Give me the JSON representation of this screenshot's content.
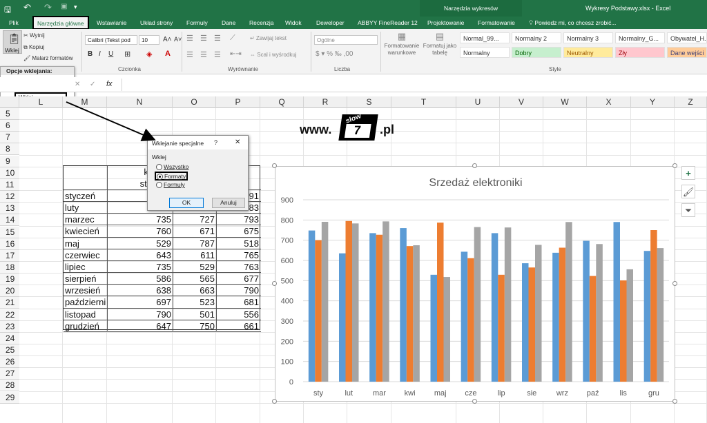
{
  "window": {
    "title": "Wykresy Podstawy.xlsx - Excel",
    "context_group": "Narzędzia wykresów",
    "tell_me": "Powiedz mi, co chcesz zrobić..."
  },
  "tabs": [
    {
      "label": "Plik"
    },
    {
      "label": "Narzędzia główne"
    },
    {
      "label": "Wstawianie"
    },
    {
      "label": "Układ strony"
    },
    {
      "label": "Formuły"
    },
    {
      "label": "Dane"
    },
    {
      "label": "Recenzja"
    },
    {
      "label": "Widok"
    },
    {
      "label": "Deweloper"
    },
    {
      "label": "ABBYY FineReader 12"
    },
    {
      "label": "Projektowanie"
    },
    {
      "label": "Formatowanie"
    }
  ],
  "ribbon": {
    "paste_label": "Wklej",
    "cut_label": "Wytnij",
    "copy_label": "Kopiuj",
    "painter_label": "Malarz formatów",
    "font_name": "Calibri (Tekst pod",
    "font_size": "10",
    "wrap_text": "Zawijaj tekst",
    "merge_center": "Scal i wyśrodkuj",
    "number_format": "Ogólne",
    "cond_format": "Formatowanie warunkowe",
    "format_table": "Formatuj jako tabelę",
    "groups": {
      "font": "Czcionka",
      "alignment": "Wyrównanie",
      "number": "Liczba",
      "style": "Style"
    },
    "styles": [
      {
        "label": "Normal_99...",
        "bg": "#ffffff",
        "color": "#333333"
      },
      {
        "label": "Normalny 2",
        "bg": "#ffffff",
        "color": "#333333"
      },
      {
        "label": "Normalny 3",
        "bg": "#ffffff",
        "color": "#333333"
      },
      {
        "label": "Normalny_G...",
        "bg": "#ffffff",
        "color": "#333333"
      },
      {
        "label": "Obywatel_H...",
        "bg": "#ffffff",
        "color": "#333333"
      },
      {
        "label": "Normalny",
        "bg": "#ffffff",
        "color": "#333333"
      },
      {
        "label": "Dobry",
        "bg": "#c6efce",
        "color": "#006100"
      },
      {
        "label": "Neutralny",
        "bg": "#ffeb9c",
        "color": "#9c5700"
      },
      {
        "label": "Zły",
        "bg": "#ffc7ce",
        "color": "#9c0006"
      },
      {
        "label": "Dane wejści",
        "bg": "#ffcc99",
        "color": "#3f3f76"
      }
    ]
  },
  "paste_menu": {
    "header": "Opcje wklejania:",
    "special": "Wklej specjalnie..."
  },
  "formula": {
    "fx": "fx",
    "cancel": "✕",
    "confirm": "✓"
  },
  "columns": [
    "L",
    "M",
    "N",
    "O",
    "P",
    "Q",
    "R",
    "S",
    "T",
    "U",
    "V",
    "W",
    "X",
    "Y",
    "Z"
  ],
  "rows": [
    "5",
    "6",
    "7",
    "8",
    "9",
    "10",
    "11",
    "12",
    "13",
    "14",
    "15",
    "16",
    "17",
    "18",
    "19",
    "20",
    "21",
    "22",
    "23",
    "24",
    "25",
    "26",
    "27",
    "28",
    "29"
  ],
  "logo": {
    "prefix": "www.",
    "top": "slow",
    "digit": "7",
    "suffix": ".pl"
  },
  "table": {
    "header_line1": "komput",
    "header_line2": "stacjona",
    "header_tail": "y",
    "rows": [
      {
        "month": "styczeń",
        "a": "",
        "b": "",
        "c": "91"
      },
      {
        "month": "luty",
        "a": "",
        "b": "",
        "c": "83"
      },
      {
        "month": "marzec",
        "a": "735",
        "b": "727",
        "c": "793"
      },
      {
        "month": "kwiecień",
        "a": "760",
        "b": "671",
        "c": "675"
      },
      {
        "month": "maj",
        "a": "529",
        "b": "787",
        "c": "518"
      },
      {
        "month": "czerwiec",
        "a": "643",
        "b": "611",
        "c": "765"
      },
      {
        "month": "lipiec",
        "a": "735",
        "b": "529",
        "c": "763"
      },
      {
        "month": "sierpień",
        "a": "586",
        "b": "565",
        "c": "677"
      },
      {
        "month": "wrzesień",
        "a": "638",
        "b": "663",
        "c": "790"
      },
      {
        "month": "październi",
        "a": "697",
        "b": "523",
        "c": "681"
      },
      {
        "month": "listopad",
        "a": "790",
        "b": "501",
        "c": "556"
      },
      {
        "month": "grudzień",
        "a": "647",
        "b": "750",
        "c": "661"
      }
    ]
  },
  "dialog": {
    "title": "Wklejanie specjalne",
    "help": "?",
    "close": "✕",
    "section": "Wklej",
    "options": [
      {
        "label": "Wszystko",
        "selected": false
      },
      {
        "label": "Formaty",
        "selected": true
      },
      {
        "label": "Formuły",
        "selected": false
      }
    ],
    "ok": "OK",
    "cancel": "Anuluj"
  },
  "chart_data": {
    "type": "bar",
    "title": "Srzedaż elektroniki",
    "categories": [
      "sty",
      "lut",
      "mar",
      "kwi",
      "maj",
      "cze",
      "lip",
      "sie",
      "wrz",
      "paź",
      "lis",
      "gru"
    ],
    "series": [
      {
        "color": "#5b9bd5",
        "values": [
          748,
          635,
          735,
          760,
          529,
          643,
          735,
          586,
          638,
          697,
          790,
          647
        ]
      },
      {
        "color": "#ed7d31",
        "values": [
          700,
          795,
          727,
          671,
          787,
          611,
          529,
          565,
          663,
          523,
          501,
          750
        ]
      },
      {
        "color": "#a5a5a5",
        "values": [
          791,
          783,
          793,
          675,
          518,
          765,
          763,
          677,
          790,
          681,
          556,
          661
        ]
      }
    ],
    "ylim": [
      0,
      900
    ],
    "yticks": [
      0,
      100,
      200,
      300,
      400,
      500,
      600,
      700,
      800,
      900
    ],
    "grid": true,
    "legend": "none"
  }
}
